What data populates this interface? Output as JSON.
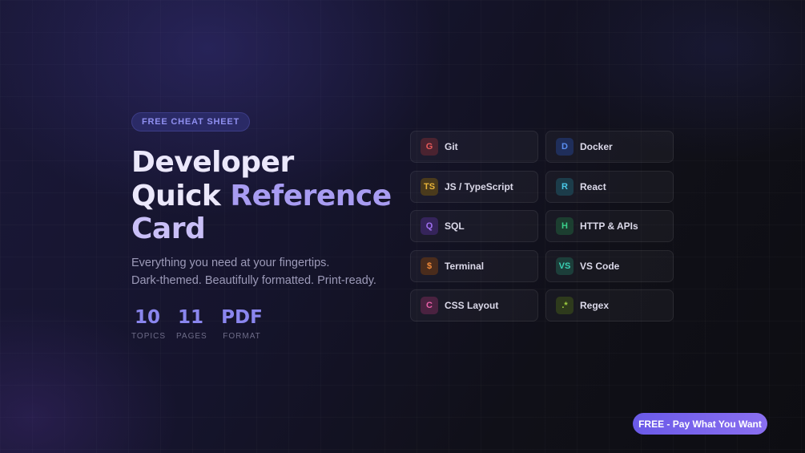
{
  "badge": "FREE CHEAT SHEET",
  "title": {
    "line1": "Developer",
    "line2a": "Quick",
    "line2b": "Reference",
    "line3": "Card"
  },
  "subtitle": {
    "line1": "Everything you need at your fingertips.",
    "line2": "Dark-themed. Beautifully formatted. Print-ready."
  },
  "stats": [
    {
      "value": "10",
      "label": "TOPICS"
    },
    {
      "value": "11",
      "label": "PAGES"
    },
    {
      "value": "PDF",
      "label": "FORMAT"
    }
  ],
  "topics": [
    {
      "icon": "G",
      "label": "Git",
      "color": "#e85a5a",
      "bg": "#4a2330"
    },
    {
      "icon": "D",
      "label": "Docker",
      "color": "#5a8ef0",
      "bg": "#1f2e5a"
    },
    {
      "icon": "TS",
      "label": "JS / TypeScript",
      "color": "#e8b43a",
      "bg": "#4a3a1c"
    },
    {
      "icon": "R",
      "label": "React",
      "color": "#4ac8e8",
      "bg": "#1c3c4a"
    },
    {
      "icon": "Q",
      "label": "SQL",
      "color": "#a070f0",
      "bg": "#35245a"
    },
    {
      "icon": "H",
      "label": "HTTP & APIs",
      "color": "#3ad08a",
      "bg": "#1c3e30"
    },
    {
      "icon": "$",
      "label": "Terminal",
      "color": "#f08a3a",
      "bg": "#4a2c1c"
    },
    {
      "icon": "VS",
      "label": "VS Code",
      "color": "#3ad0b4",
      "bg": "#1c3e3a"
    },
    {
      "icon": "C",
      "label": "CSS Layout",
      "color": "#e860a8",
      "bg": "#4a2240"
    },
    {
      "icon": ".*",
      "label": "Regex",
      "color": "#a0d040",
      "bg": "#2e3a1c"
    }
  ],
  "cta": "FREE - Pay What You Want"
}
